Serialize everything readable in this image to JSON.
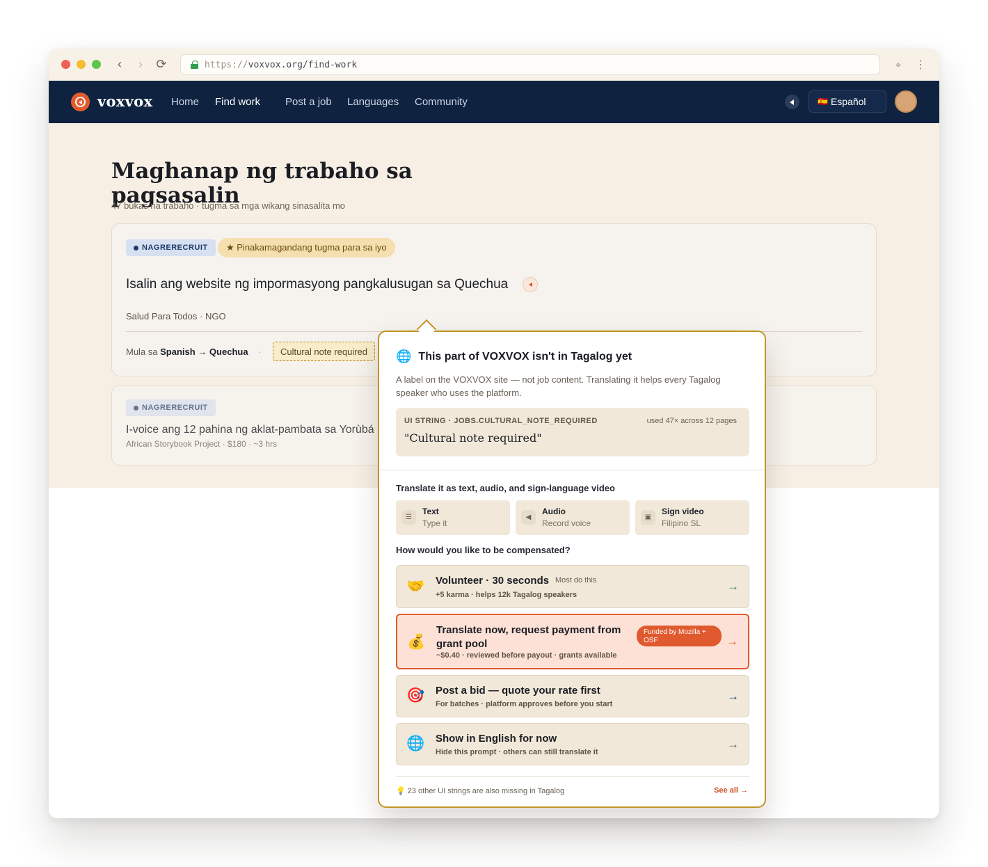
{
  "browser": {
    "url_scheme": "https://",
    "url_rest": "voxvox.org/find-work",
    "back_icon": "chevron-left-icon",
    "forward_icon": "chevron-right-icon",
    "reload_icon": "reload-icon",
    "lock_icon": "lock-icon",
    "extension_icon": "crosshair-icon",
    "menu_icon": "kebab-icon"
  },
  "nav": {
    "brand": "voxvox",
    "links": [
      "Home",
      "Find work",
      "Post a job",
      "Languages",
      "Community"
    ],
    "active": "Find work",
    "language": "Español",
    "language_flag": "🇪🇸",
    "colors": {
      "background": "#0f2240",
      "brand": "#e35b2c"
    }
  },
  "page": {
    "title": "Maghanap ng trabaho sa pagsasalin",
    "subtitle": "47 bukas na trabaho · tugma sa mga wikang sinasalita mo"
  },
  "jobs": [
    {
      "status": "NAGRERECRUIT",
      "match_badge": "★ Pinakamagandang tugma para sa iyo",
      "title": "Isalin ang website ng impormasyong pangkalusugan sa Quechua",
      "org": "Salud Para Todos · NGO",
      "meta_prefix": "Mula sa ",
      "meta_pair": "Spanish → Quechua",
      "meta_sep": "·",
      "cultural_chip": "Cultural note required"
    },
    {
      "status": "NAGRERECRUIT",
      "title": "I-voice ang 12 pahina ng aklat-pambata sa Yorùbá",
      "meta": "African Storybook Project · $180 · ~3 hrs"
    }
  ],
  "popover": {
    "title": "This part of VOXVOX isn't in Tagalog yet",
    "title_icon": "globe-icon",
    "description": "A label on the VOXVOX site — not job content. Translating it helps every Tagalog speaker who uses the platform.",
    "string_label": "UI STRING · JOBS.CULTURAL_NOTE_REQUIRED",
    "string_usage": "used 47× across 12 pages",
    "string_value": "\"Cultural note required\"",
    "modes_label": "Translate it as text, audio, and sign-language video",
    "modes": [
      {
        "name": "Text",
        "sub": "Type it",
        "icon": "text-lines-icon"
      },
      {
        "name": "Audio",
        "sub": "Record voice",
        "icon": "speaker-icon"
      },
      {
        "name": "Sign video",
        "sub": "Filipino SL",
        "icon": "video-camera-icon"
      }
    ],
    "comp_label": "How would you like to be compensated?",
    "options": [
      {
        "emoji": "🤝",
        "title": "Volunteer · 30 seconds",
        "tag": "Most do this",
        "sub": "+5 karma · helps 12k Tagalog speakers",
        "arrow": "→"
      },
      {
        "emoji": "💰",
        "title": "Translate now, request payment from grant pool",
        "funded": "Funded by Mozilla + OSF",
        "sub": "~$0.40 · reviewed before payout · grants available",
        "arrow": "→"
      },
      {
        "emoji": "🎯",
        "title": "Post a bid — quote your rate first",
        "sub": "For batches · platform approves before you start",
        "arrow": "→"
      },
      {
        "emoji": "🌐",
        "title": "Show in English for now",
        "sub": "Hide this prompt · others can still translate it",
        "arrow": "→"
      }
    ],
    "footer": "💡 23 other UI strings are also missing in Tagalog",
    "see_all": "See all →",
    "colors": {
      "border": "#c19327",
      "accent": "#e05a2f"
    }
  }
}
